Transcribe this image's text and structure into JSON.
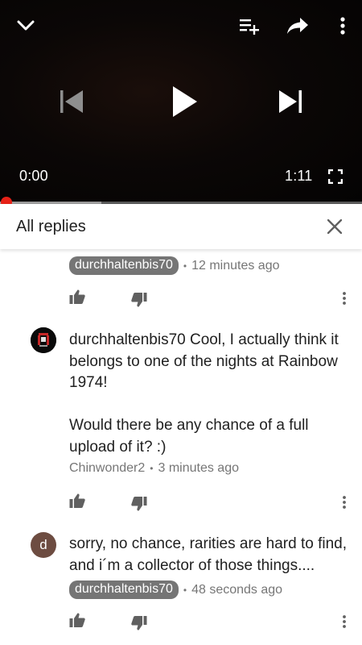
{
  "player": {
    "current_time": "0:00",
    "total_time": "1:11",
    "progress": 0.0,
    "buffered": 0.28,
    "progress_color": "#e62117"
  },
  "replies_header": {
    "title": "All replies",
    "close_icon": "close-icon"
  },
  "comments": [
    {
      "author_chip": "durchhaltenbis70",
      "time": "12 minutes ago"
    },
    {
      "avatar": "profile-picture",
      "text_para1": "durchhaltenbis70 Cool, I actually think it belongs to one of the nights at Rainbow 1974!",
      "text_para2": "Would there be any chance of a full upload of it? :)",
      "author": "Chinwonder2",
      "time": "3 minutes ago"
    },
    {
      "avatar_initial": "d",
      "text": "sorry, no chance, rarities are hard to find, and i´m a collector of those things....",
      "author_chip": "durchhaltenbis70",
      "time": "48 seconds ago"
    }
  ]
}
